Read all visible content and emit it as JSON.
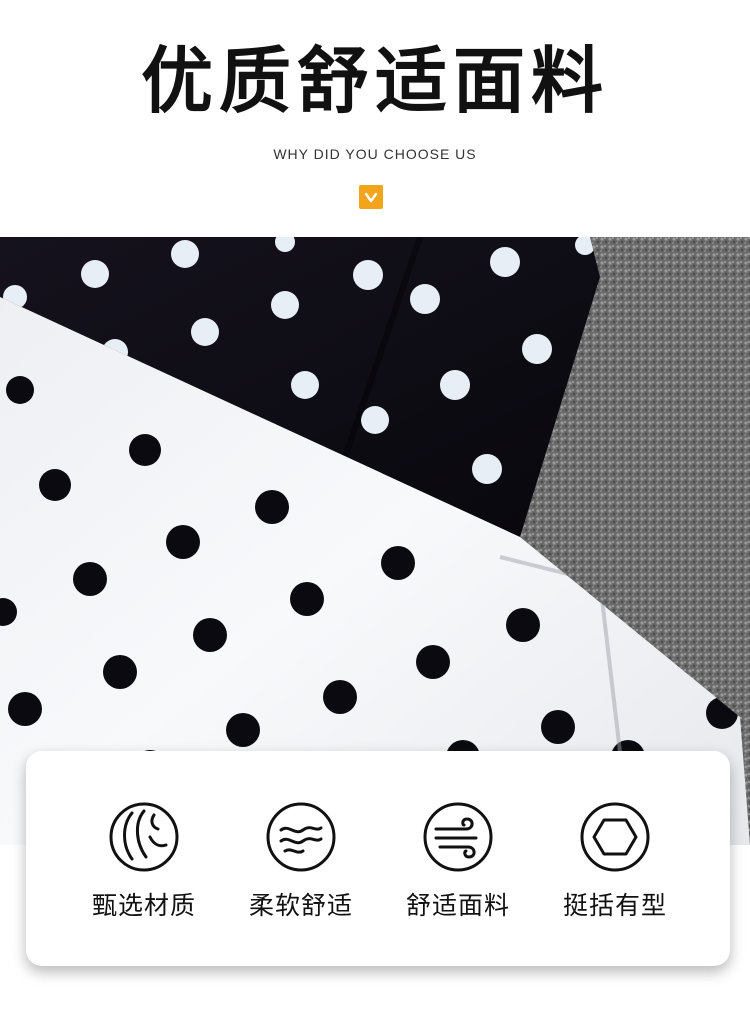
{
  "header": {
    "title": "优质舒适面料",
    "subtitle": "WHY DID YOU CHOOSE US",
    "badge_icon": "chevron-down-icon",
    "badge_color": "#f2a51a"
  },
  "photo": {
    "subject": "polka-dot fabric swatches",
    "colors": {
      "black_fabric": "#0c0a14",
      "white_fabric": "#f4f5f8",
      "gray_knit": "#6d6d6d"
    }
  },
  "features": [
    {
      "label": "甄选材质",
      "icon": "fiber-icon"
    },
    {
      "label": "柔软舒适",
      "icon": "soft-wave-icon"
    },
    {
      "label": "舒适面料",
      "icon": "breathable-wind-icon"
    },
    {
      "label": "挺括有型",
      "icon": "hexagon-icon"
    }
  ]
}
